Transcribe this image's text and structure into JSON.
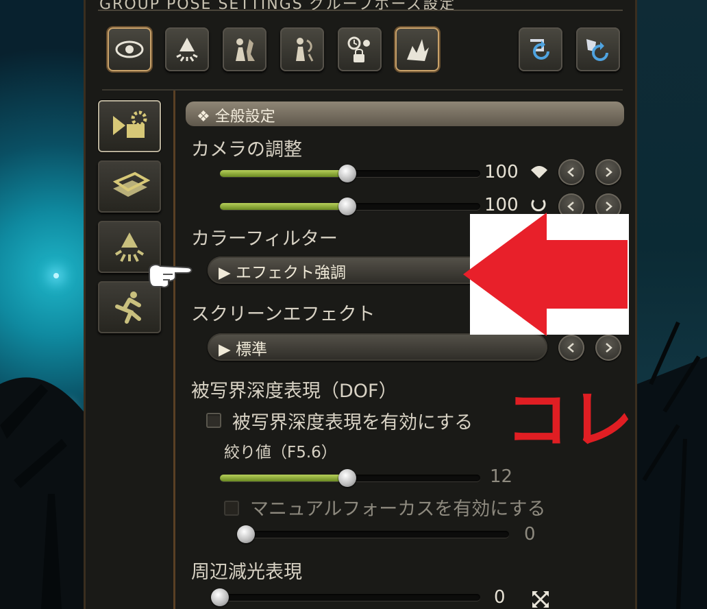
{
  "window": {
    "title": "GROUP POSE SETTINGS グループポーズ設定"
  },
  "top_icons": [
    {
      "name": "eye-icon",
      "active": true
    },
    {
      "name": "lamp-icon",
      "active": false
    },
    {
      "name": "character-a-icon",
      "active": false
    },
    {
      "name": "character-b-icon",
      "active": false
    },
    {
      "name": "time-lock-icon",
      "active": false
    },
    {
      "name": "effect-icon",
      "active": true
    }
  ],
  "top_right_icons": [
    "reset-icon",
    "reset-all-icon"
  ],
  "side_icons": [
    {
      "name": "camera-settings-icon",
      "active": true
    },
    {
      "name": "frame-icon",
      "active": false
    },
    {
      "name": "lighting-icon",
      "active": false
    },
    {
      "name": "motion-icon",
      "active": false
    }
  ],
  "section": {
    "title": "全般設定"
  },
  "camera": {
    "label": "カメラの調整",
    "slider1_value": "100",
    "slider1_fraction": 0.49,
    "slider2_value": "100",
    "slider2_fraction": 0.49
  },
  "color_filter": {
    "label": "カラーフィルター",
    "value": "エフェクト強調"
  },
  "screen_effect": {
    "label": "スクリーンエフェクト",
    "value": "標準"
  },
  "dof": {
    "label": "被写界深度表現（DOF）",
    "enable_label": "被写界深度表現を有効にする",
    "aperture_label": "絞り値（F5.6）",
    "aperture_value": "12",
    "aperture_fraction": 0.49,
    "manual_focus_label": "マニュアルフォーカスを有効にする",
    "manual_value": "0",
    "manual_fraction": 0.0
  },
  "vignette": {
    "label": "周辺減光表現",
    "value": "0",
    "fraction": 0.0
  },
  "annotation": {
    "text": "コレ",
    "arrow_color": "#e8202a"
  },
  "colors": {
    "accent_green": "#9bbf3c",
    "panel": "#1a1a17",
    "annotation_red": "#e01e23"
  }
}
